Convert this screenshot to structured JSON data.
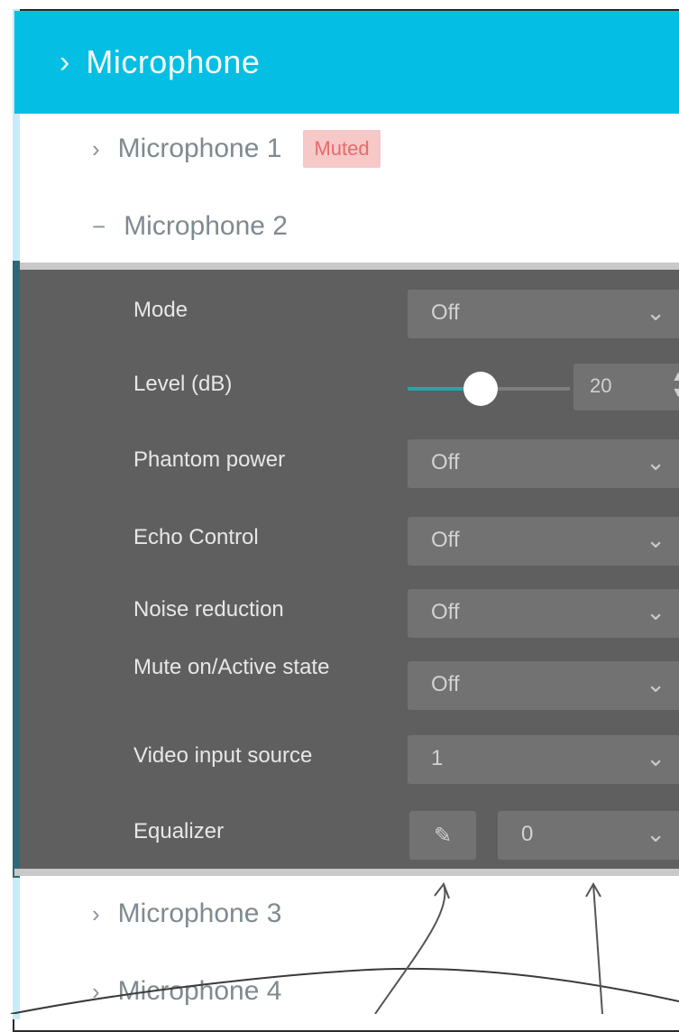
{
  "header": {
    "title": "Microphone",
    "chevron_icon": "chevron-right-icon"
  },
  "list": [
    {
      "label": "Microphone 1",
      "state": "collapsed",
      "badge": "Muted"
    },
    {
      "label": "Microphone 2",
      "state": "expanded"
    },
    {
      "label": "Microphone 3",
      "state": "collapsed"
    },
    {
      "label": "Microphone 4",
      "state": "collapsed"
    }
  ],
  "panel": {
    "rows": [
      {
        "label": "Mode",
        "type": "dropdown",
        "value": "Off"
      },
      {
        "label": "Level (dB)",
        "type": "slider",
        "value": "20",
        "fraction": 0.45
      },
      {
        "label": "Phantom power",
        "type": "dropdown",
        "value": "Off"
      },
      {
        "label": "Echo Control",
        "type": "dropdown",
        "value": "Off"
      },
      {
        "label": "Noise reduction",
        "type": "dropdown",
        "value": "Off"
      },
      {
        "label": "Mute on/Active state",
        "type": "dropdown",
        "value": "Off"
      },
      {
        "label": "Video input source",
        "type": "dropdown",
        "value": "1"
      },
      {
        "label": "Equalizer",
        "type": "equalizer",
        "value": "0"
      }
    ]
  },
  "colors": {
    "header_bg": "#04bfe3",
    "panel_bg": "#5f5f5f",
    "badge_bg": "#f6c8c8",
    "slider_fill": "#2aa4a8"
  },
  "icons": {
    "row_collapsed": "chevron-right-icon",
    "row_expanded": "minus-icon",
    "dropdown": "chevron-down-icon",
    "edit": "pencil-icon",
    "stepper": "stepper-arrows-icon"
  }
}
